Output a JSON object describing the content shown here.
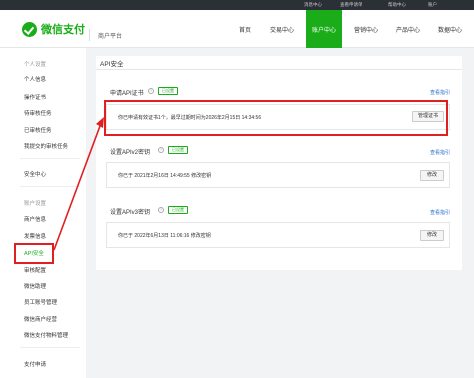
{
  "topbar": {
    "messages": "消息中心",
    "phone_bind": "查看申请单",
    "help": "帮助中心",
    "account": "账户"
  },
  "header": {
    "logo_text": "微信支付",
    "subtitle": "商户平台",
    "nav": [
      "首页",
      "交易中心",
      "账户中心",
      "营销中心",
      "产品中心",
      "数据中心"
    ],
    "active_nav": "账户中心"
  },
  "sidebar": {
    "group_personal": "个人设置",
    "personal_items": [
      "个人信息",
      "操作证书",
      "待审核任务",
      "已审核任务",
      "我提交的审核任务"
    ],
    "security": "安全中心",
    "group_account": "账户设置",
    "account_items": [
      "商户信息",
      "发票信息",
      "API安全",
      "审核配置",
      "微信助理",
      "员工账号管理",
      "微信商户经营",
      "微信支付物料管理"
    ],
    "pay_apply": "支付申请"
  },
  "main": {
    "title": "API安全",
    "sections": [
      {
        "title": "申请API证书",
        "tag": "已设置",
        "guide": "查看指引",
        "text": "你已申请有效证书1个，最早过期时间为2026年2月15日 14:34:56",
        "button": "管理证书"
      },
      {
        "title": "设置APIv2密钥",
        "tag": "已设置",
        "guide": "查看指引",
        "text": "你已于 2021年2月16日 14:49:55 修改密钥",
        "button": "修改"
      },
      {
        "title": "设置APIv3密钥",
        "tag": "已设置",
        "guide": "查看指引",
        "text": "你已于 2022年6月13日 11:06:16 修改密钥",
        "button": "修改"
      }
    ]
  },
  "colors": {
    "brand": "#1aad19",
    "highlight": "#e02020",
    "link": "#2a6ecb"
  }
}
